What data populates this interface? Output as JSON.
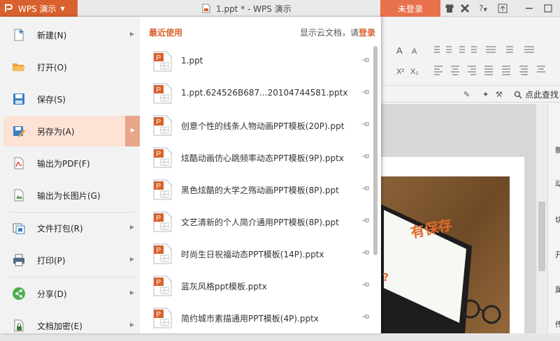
{
  "titlebar": {
    "app_menu_label": "WPS 演示",
    "document_title": "1.ppt * - WPS 演示",
    "login_button": "未登录",
    "help_label": "?"
  },
  "ribbon": {
    "find_command": "点此查找"
  },
  "file_menu": {
    "items": [
      {
        "label": "新建(N)",
        "icon": "new-file-icon",
        "has_submenu": true
      },
      {
        "label": "打开(O)",
        "icon": "open-folder-icon",
        "has_submenu": false
      },
      {
        "label": "保存(S)",
        "icon": "save-icon",
        "has_submenu": false
      },
      {
        "label": "另存为(A)",
        "icon": "save-as-icon",
        "has_submenu": true,
        "active": true
      },
      {
        "label": "输出为PDF(F)",
        "icon": "pdf-icon",
        "has_submenu": false
      },
      {
        "label": "输出为长图片(G)",
        "icon": "image-export-icon",
        "has_submenu": false
      },
      {
        "label": "文件打包(R)",
        "icon": "package-icon",
        "has_submenu": true
      },
      {
        "label": "打印(P)",
        "icon": "print-icon",
        "has_submenu": true
      },
      {
        "label": "分享(D)",
        "icon": "share-icon",
        "has_submenu": true
      },
      {
        "label": "文档加密(E)",
        "icon": "lock-icon",
        "has_submenu": true
      }
    ],
    "recent_heading": "最近使用",
    "cloud_hint_prefix": "显示云文档，请",
    "cloud_hint_link": "登录",
    "recent_files": [
      "1.ppt",
      "1.ppt.624526B687...20104744581.pptx",
      "创意个性的线条人物动画PPT模板(20P).ppt",
      "炫酷动画仿心跳频率动态PPT模板(9P).pptx",
      "黑色炫酷的大学之殇动画PPT模板(8P).ppt",
      "文艺清新的个人简介通用PPT模板(8P).ppt",
      "时尚生日祝福动态PPT模板(14P).pptx",
      "蓝灰风格ppt模板.pptx",
      "简约城市素描通用PPT模板(4P).pptx"
    ]
  },
  "slide": {
    "visible_text": "有保存"
  },
  "right_pane": {
    "items": [
      "新",
      "动",
      "切",
      "开",
      "属",
      "传"
    ]
  },
  "colors": {
    "brand": "#d9612e",
    "login_button": "#e8704a",
    "active_item": "#fde2d6"
  }
}
